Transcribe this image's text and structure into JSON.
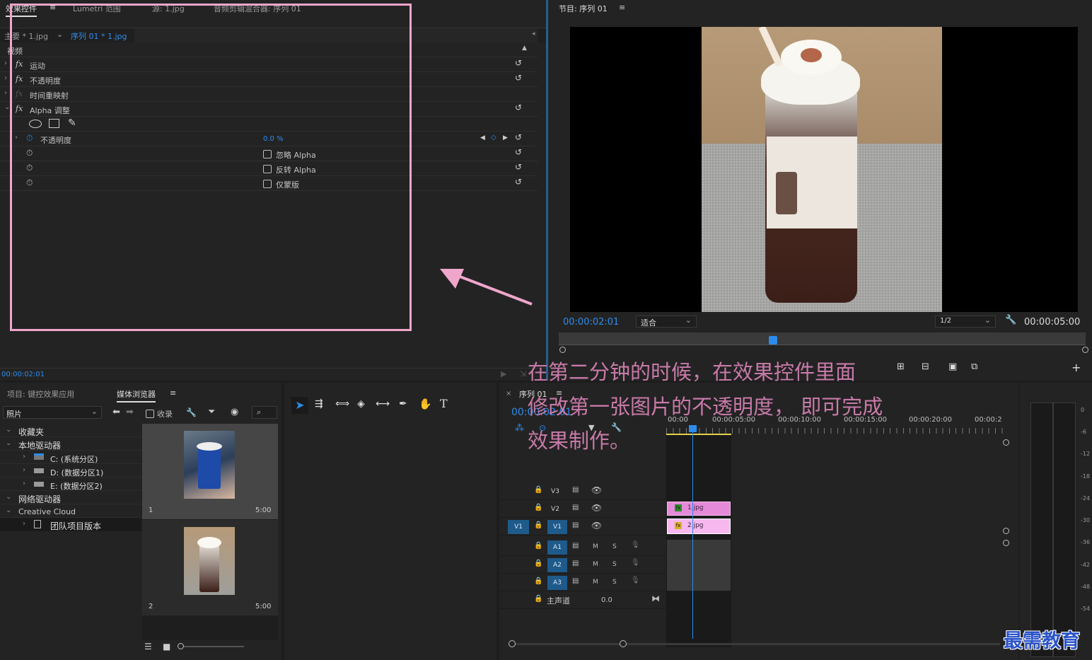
{
  "effects_panel": {
    "tabs": [
      "效果控件",
      "Lumetri 范围",
      "源: 1.jpg",
      "音频剪辑混合器: 序列 01"
    ],
    "source_label": "主要 * 1.jpg",
    "sequence_label": "序列 01 * 1.jpg",
    "section": "视频",
    "effects": [
      {
        "name": "运动"
      },
      {
        "name": "不透明度"
      },
      {
        "name": "时间重映射"
      },
      {
        "name": "Alpha 调整"
      }
    ],
    "param_opacity_label": "不透明度",
    "param_opacity_value": "0.0 %",
    "checkbox_ignore_alpha": "忽略 Alpha",
    "checkbox_invert_alpha": "反转 Alpha",
    "checkbox_mask_only": "仅蒙版",
    "timecode": "00:00:02:01"
  },
  "program_monitor": {
    "title": "节目: 序列 01",
    "timecode_current": "00:00:02:01",
    "fit_label": "适合",
    "resolution": "1/2",
    "timecode_duration": "00:00:05:00"
  },
  "project_panel": {
    "tabs": [
      "项目: 键控效果应用",
      "媒体浏览器"
    ],
    "filter_select": "照片",
    "ingest_label": "收录",
    "tree": [
      {
        "label": "收藏夹"
      },
      {
        "label": "本地驱动器"
      },
      {
        "label": "C: (系统分区)"
      },
      {
        "label": "D: (数据分区1)"
      },
      {
        "label": "E: (数据分区2)"
      },
      {
        "label": "网络驱动器"
      },
      {
        "label": "Creative Cloud"
      },
      {
        "label": "团队项目版本"
      }
    ],
    "thumbnails": [
      {
        "index": "1",
        "duration": "5:00"
      },
      {
        "index": "2",
        "duration": "5:00"
      }
    ]
  },
  "timeline": {
    "title": "序列 01",
    "timecode": "00:00:02:01",
    "ruler": [
      "00:00",
      "00:00:05:00",
      "00:00:10:00",
      "00:00:15:00",
      "00:00:20:00",
      "00:00:2"
    ],
    "tracks_video": [
      "V3",
      "V2",
      "V1"
    ],
    "source_patch": "V1",
    "tracks_audio": [
      "A1",
      "A2",
      "A3"
    ],
    "master_label": "主声道",
    "master_value": "0.0",
    "mute": "M",
    "solo": "S",
    "clip_v2": "1.jpg",
    "clip_v1": "2.jpg"
  },
  "meter_scale": [
    "0",
    "-6",
    "-12",
    "-18",
    "-24",
    "-30",
    "-36",
    "-42",
    "-48",
    "-54"
  ],
  "annotation": {
    "line1": "在第二分钟的时候，在效果控件里面",
    "line2": "修改第一张图片的不透明度，  即可完成",
    "line3": "效果制作。"
  },
  "watermark": "最需教育",
  "colors": {
    "accent_blue": "#2d8ceb",
    "annotation_pink": "#f3a6c8",
    "clip_pink": "#e58ad8",
    "clip_v1": "#f6b8ee"
  }
}
